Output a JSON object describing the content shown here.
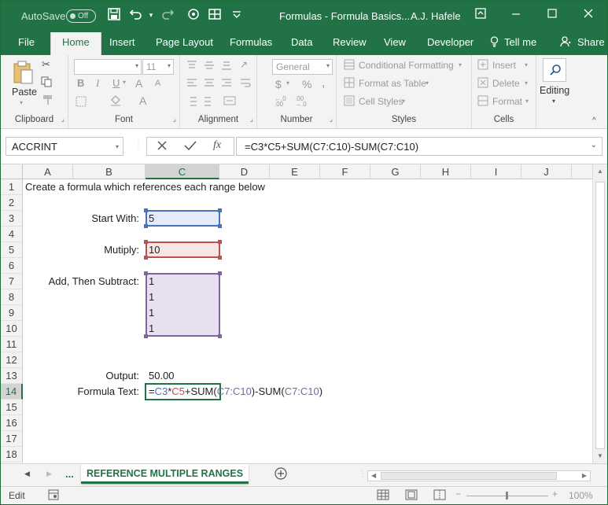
{
  "title_bar": {
    "autosave_label": "AutoSave",
    "autosave_state": "Off",
    "title": "Formulas - Formula Basics...",
    "user": "A.J. Hafele",
    "icons": [
      "save-icon",
      "undo-icon",
      "redo-icon",
      "touch-mode-icon",
      "ribbon-display-icon",
      "minimize-icon",
      "maximize-icon",
      "close-icon"
    ]
  },
  "tabs": [
    "File",
    "Home",
    "Insert",
    "Page Layout",
    "Formulas",
    "Data",
    "Review",
    "View",
    "Developer",
    "Tell me",
    "Share"
  ],
  "active_tab": "Home",
  "ribbon": {
    "clipboard": {
      "paste": "Paste",
      "label": "Clipboard"
    },
    "font": {
      "label": "Font",
      "name": "",
      "size": "11",
      "bold": "B",
      "italic": "I",
      "underline": "U",
      "grow": "A",
      "shrink": "A",
      "font_color": "A"
    },
    "alignment": {
      "label": "Alignment"
    },
    "number": {
      "label": "Number",
      "format": "General",
      "currency": "$",
      "percent": "%",
      "comma": ","
    },
    "styles": {
      "label": "Styles",
      "conditional": "Conditional Formatting",
      "format_table": "Format as Table",
      "cell_styles": "Cell Styles"
    },
    "cells": {
      "label": "Cells",
      "insert": "Insert",
      "delete": "Delete",
      "format": "Format"
    },
    "editing": {
      "label": "Editing"
    }
  },
  "formula_bar": {
    "name_box": "ACCRINT",
    "fx": "fx",
    "formula": "=C3*C5+SUM(C7:C10)-SUM(C7:C10)"
  },
  "columns": [
    "A",
    "B",
    "C",
    "D",
    "E",
    "F",
    "G",
    "H",
    "I",
    "J"
  ],
  "selected_column": "C",
  "rows": [
    "1",
    "2",
    "3",
    "4",
    "5",
    "6",
    "7",
    "8",
    "9",
    "10",
    "11",
    "12",
    "13",
    "14",
    "15",
    "16",
    "17",
    "18"
  ],
  "selected_row": "14",
  "sheet": {
    "a1": "Create a formula which references each range below",
    "b3": "Start With:",
    "c3": "5",
    "b5": "Mutiply:",
    "c5": "10",
    "b7": "Add, Then Subtract:",
    "c7": "1",
    "c8": "1",
    "c9": "1",
    "c10": "1",
    "b13": "Output:",
    "c13": "50.00",
    "b14": "Formula Text:",
    "c14_parts": [
      "=",
      "C3",
      "*",
      "C5",
      "+SUM(",
      "C7:C10",
      ")-SUM(",
      "C7:C10",
      ")"
    ]
  },
  "range_colors": {
    "c3": "#4472c4",
    "c5": "#c0504d",
    "c7_c10": "#8064a2",
    "active": "#217346"
  },
  "sheet_tabs": {
    "more": "...",
    "active": "REFERENCE MULTIPLE RANGES"
  },
  "status": {
    "mode": "Edit",
    "zoom": "100%",
    "zoom_minus": "−",
    "zoom_plus": "+"
  }
}
